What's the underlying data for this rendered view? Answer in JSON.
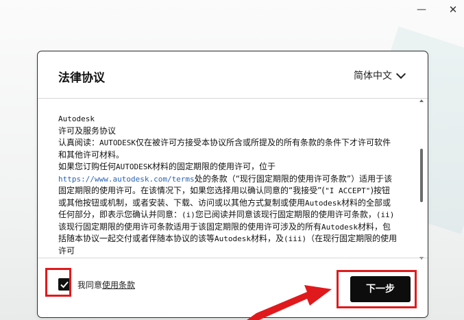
{
  "window": {
    "minimize_glyph": "—",
    "close_glyph": "✕"
  },
  "dialog": {
    "title": "法律协议",
    "language": "简体中文"
  },
  "terms": {
    "line1": "Autodesk",
    "line2": "许可及服务协议",
    "line3a": "认真阅读：",
    "line3b": "AUTODESK",
    "line3c": "仅在被许可方接受本协议所含或所提及的所有条款的条件下才许可软件和其他许可材料。",
    "line4a": "如果您订购任何",
    "line4b": "AUTODESK",
    "line4c": "材料的固定期限的使用许可，位于",
    "link": "https://www.autodesk.com/terms",
    "line5a": "处的条款（“现行固定期限的使用许可条款”）适用于该固定期限的使用许可。在该情况下，如果您选择用以确认同意的“我接受”(",
    "line5b": "\"I ACCEPT\"",
    "line5c": ")按钮或其他按钮或机制，或者安装、下载、访问或以其他方式复制或使用",
    "line5d": "Autodesk",
    "line5e": "材料的全部或任何部分，即表示您确认并同意：",
    "line5f": "(i)",
    "line5g": "您已阅读并同意该现行固定期限的使用许可条款，",
    "line5h": "(ii)",
    "line5i": "该现行固定期限的使用许可条款适用于该固定期限的使用许可涉及的所有",
    "line5j": "Autodesk",
    "line5k": "材料，包括随本协议一起交付或者伴随本协议的该等",
    "line5l": "Autodesk",
    "line5m": "材料，及",
    "line5n": "(iii)",
    "line5o": "（在现行固定期限的使用许可"
  },
  "footer": {
    "agree_prefix": "我同意",
    "agree_link": "使用条款",
    "next_label": "下一步",
    "checked": true
  },
  "colors": {
    "highlight": "#e0191c",
    "link": "#2b63b5",
    "button": "#0d0d0d"
  }
}
